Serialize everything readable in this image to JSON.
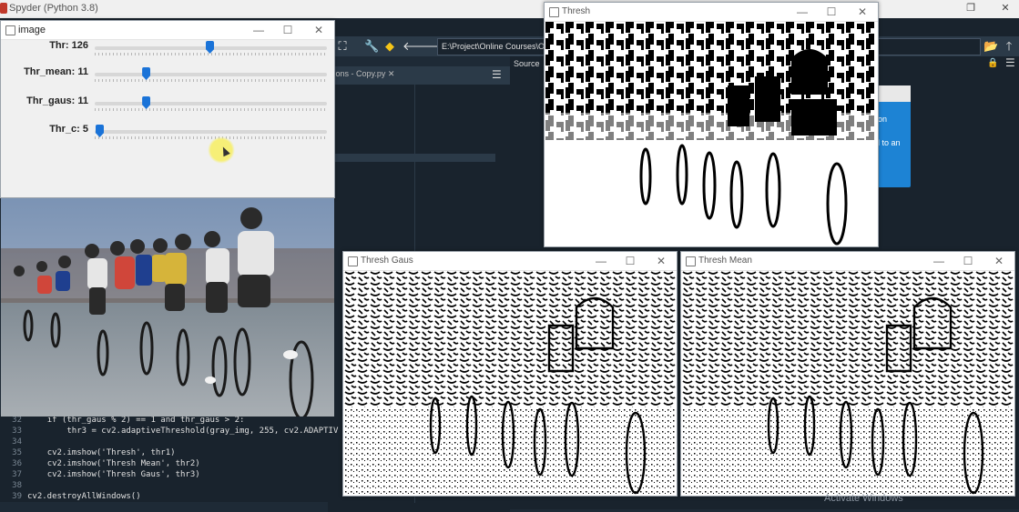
{
  "spyder": {
    "title": "Spyder (Python 3.8)",
    "path": "E:\\Project\\Online Courses\\OpenC",
    "editor_tab": "tions - Copy.py",
    "source_label": "Source",
    "info_line1": "on",
    "info_line2": "l to an"
  },
  "image_window": {
    "title": "image",
    "trackbars": [
      {
        "label": "Thr: 126",
        "value": 126,
        "max": 255
      },
      {
        "label": "Thr_mean: 11",
        "value": 11,
        "max": 50
      },
      {
        "label": "Thr_gaus: 11",
        "value": 11,
        "max": 50
      },
      {
        "label": "Thr_c: 5",
        "value": 5,
        "max": 255
      }
    ]
  },
  "windows": {
    "thresh": "Thresh",
    "gaus": "Thresh Gaus",
    "mean": "Thresh Mean"
  },
  "code": [
    {
      "ln": "32",
      "text": "if (thr_gaus % 2) == 1 and thr_gaus > 2:"
    },
    {
      "ln": "33",
      "text": "thr3 = cv2.adaptiveThreshold(gray_img, 255, cv2.ADAPTIV"
    },
    {
      "ln": "34",
      "text": ""
    },
    {
      "ln": "35",
      "text": "cv2.imshow('Thresh', thr1)"
    },
    {
      "ln": "36",
      "text": "cv2.imshow('Thresh Mean', thr2)"
    },
    {
      "ln": "37",
      "text": "cv2.imshow('Thresh Gaus', thr3)"
    },
    {
      "ln": "38",
      "text": ""
    },
    {
      "ln": "39",
      "text": "cv2.destroyAllWindows()"
    }
  ],
  "watermark": "Activate Windows",
  "icons": {
    "close": "close-icon",
    "minimize": "minimize-icon",
    "maximize": "maximize-icon"
  },
  "colors": {
    "accent": "#1a73d8",
    "spyder_bg": "#19232d",
    "info_blue": "#1d83d4"
  }
}
